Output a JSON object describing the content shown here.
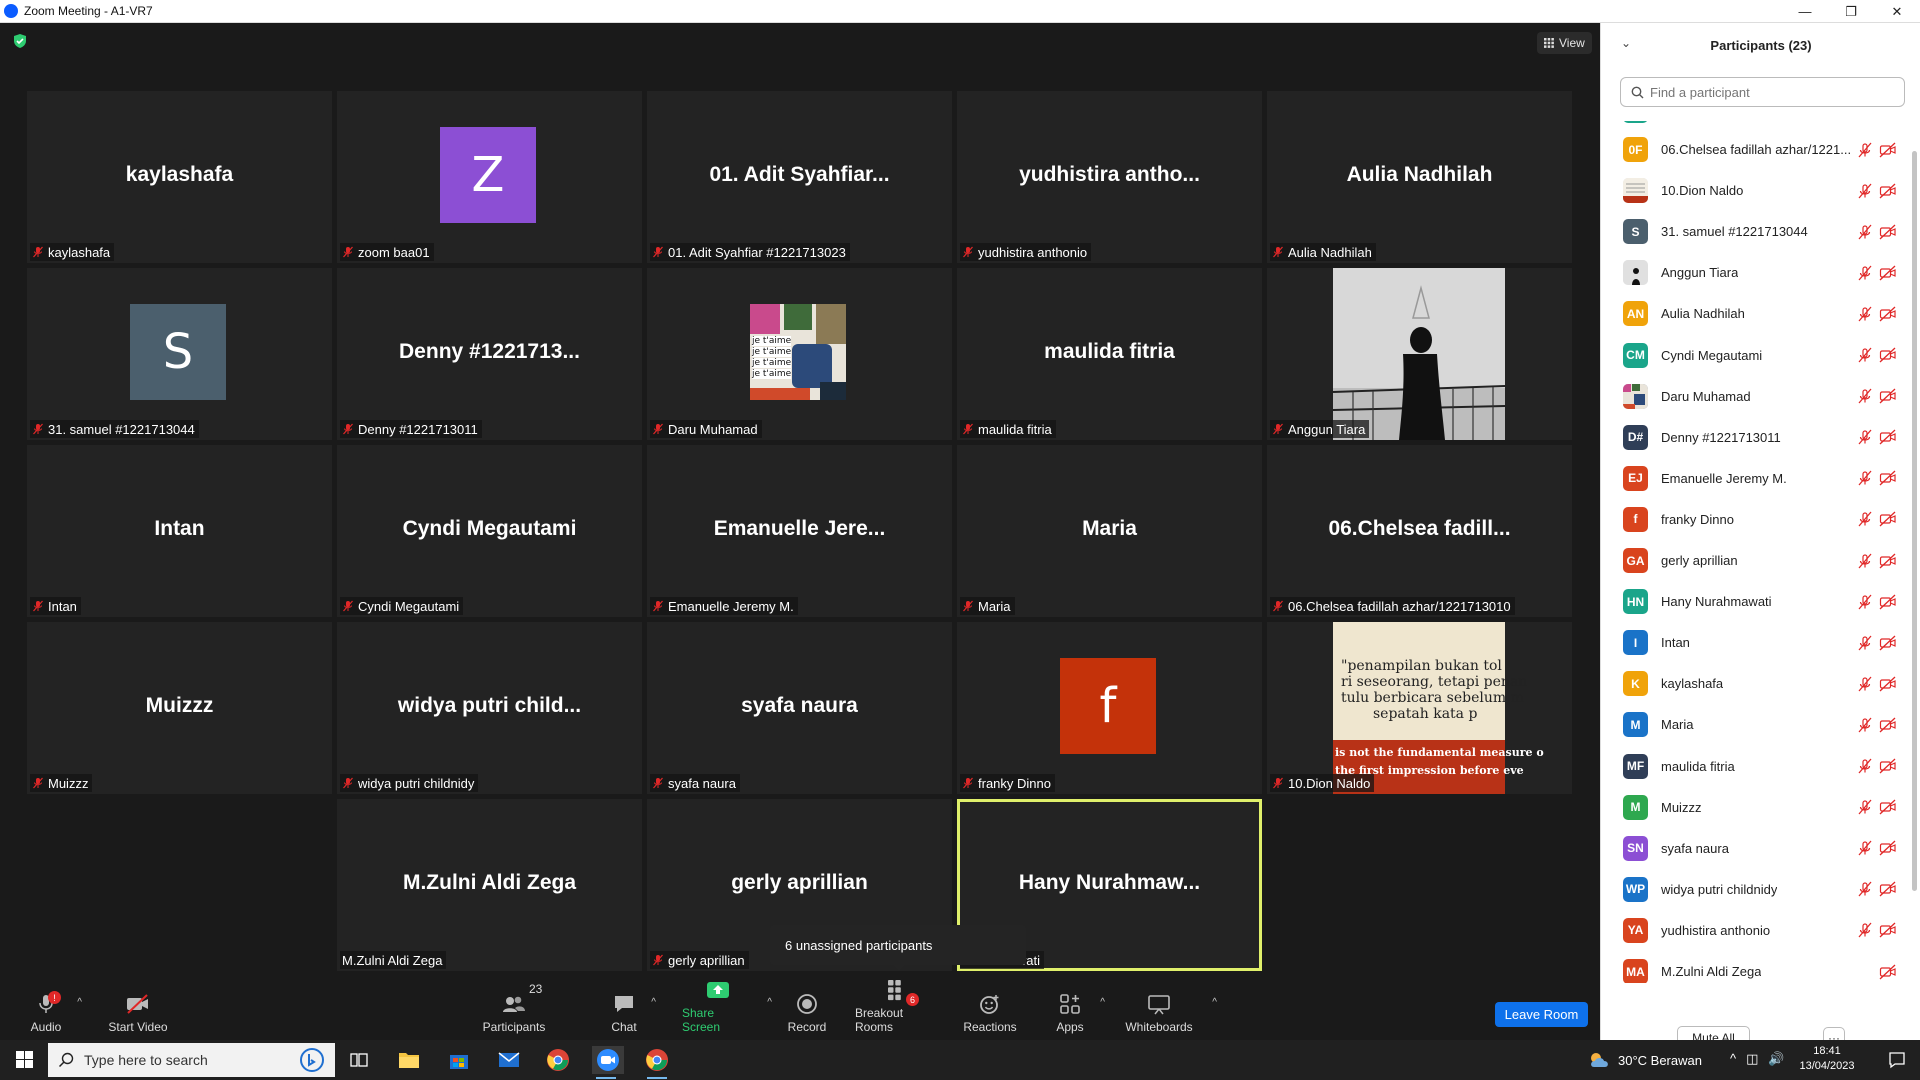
{
  "window": {
    "title": "Zoom Meeting - A1-VR7",
    "controls": [
      "—",
      "❐",
      "✕"
    ]
  },
  "meeting": {
    "view_label": "View",
    "tiles": [
      {
        "bigname": "kaylashafa",
        "label": "kaylashafa",
        "muted": true
      },
      {
        "bigname": "",
        "avatar_letter": "Z",
        "avatar_color": "#8c4fd4",
        "label": "zoom baa01",
        "muted": true
      },
      {
        "bigname": "01. Adit Syahfiar...",
        "label": "01. Adit Syahfiar #1221713023",
        "muted": true
      },
      {
        "bigname": "yudhistira  antho...",
        "label": "yudhistira anthonio",
        "muted": true
      },
      {
        "bigname": "Aulia Nadhilah",
        "label": "Aulia Nadhilah",
        "muted": true
      },
      {
        "bigname": "",
        "avatar_letter": "S",
        "avatar_color": "#4b5f6d",
        "label": "31. samuel #1221713044",
        "muted": true
      },
      {
        "bigname": "Denny #1221713...",
        "label": "Denny #1221713011",
        "muted": true
      },
      {
        "bigname": "",
        "photo": "collage",
        "photo_text": [
          "je t'aime",
          "je t'aime",
          "je t'aime",
          "je t'aime"
        ],
        "label": "Daru Muhamad",
        "muted": true
      },
      {
        "bigname": "maulida fitria",
        "label": "maulida fitria",
        "muted": true
      },
      {
        "bigname": "",
        "photo": "bw",
        "label": "Anggun Tiara",
        "muted": true
      },
      {
        "bigname": "Intan",
        "label": "Intan",
        "muted": true
      },
      {
        "bigname": "Cyndi Megautami",
        "label": "Cyndi Megautami",
        "muted": true
      },
      {
        "bigname": "Emanuelle  Jere...",
        "label": "Emanuelle Jeremy M.",
        "muted": true
      },
      {
        "bigname": "Maria",
        "label": "Maria",
        "muted": true
      },
      {
        "bigname": "06.Chelsea  fadill...",
        "label": "06.Chelsea fadillah azhar/1221713010",
        "muted": true
      },
      {
        "bigname": "Muizzz",
        "label": "Muizzz",
        "muted": true
      },
      {
        "bigname": "widya  putri  child...",
        "label": "widya putri childnidy",
        "muted": true
      },
      {
        "bigname": "syafa naura",
        "label": "syafa naura",
        "muted": true
      },
      {
        "bigname": "",
        "avatar_letter": "f",
        "avatar_color": "#c4320a",
        "label": "franky Dinno",
        "muted": true
      },
      {
        "bigname": "",
        "photo": "quote",
        "photo_text": [
          "\"penampilan bukan tol",
          "ri seseorang, tetapi penan",
          "tulu berbicara sebelum m",
          "sepatah kata p",
          "is not the fundamental measure o",
          "the first impression before eve"
        ],
        "label": "10.Dion Naldo",
        "muted": true
      },
      {
        "bigname": "M.Zulni Aldi Zega",
        "label": "M.Zulni Aldi Zega",
        "muted": false
      },
      {
        "bigname": "gerly aprillian",
        "label": "gerly aprillian",
        "muted": true
      },
      {
        "bigname": "Hany  Nurahmaw...",
        "label": "...urahmawati",
        "muted": false,
        "active": true
      }
    ],
    "tooltip": "6 unassigned participants"
  },
  "toolbar": {
    "audio": "Audio",
    "audio_badge": "!",
    "start_video": "Start Video",
    "participants": "Participants",
    "participants_count": "23",
    "chat": "Chat",
    "share_screen": "Share Screen",
    "record": "Record",
    "breakout_rooms": "Breakout Rooms",
    "breakout_badge": "6",
    "reactions": "Reactions",
    "apps": "Apps",
    "whiteboards": "Whiteboards",
    "leave_room": "Leave Room"
  },
  "participants_panel": {
    "title": "Participants (23)",
    "search_placeholder": "Find a participant",
    "mute_all": "Mute All",
    "more": "···",
    "list": [
      {
        "initials": "0F",
        "color": "#f0a30a",
        "name": "06.Chelsea fadillah azhar/1221...",
        "cam": true
      },
      {
        "initials": "",
        "color": "#d9d9d9",
        "photo": "paper",
        "name": "10.Dion Naldo",
        "cam": true
      },
      {
        "initials": "S",
        "color": "#4b5f6d",
        "name": "31. samuel #1221713044",
        "cam": true
      },
      {
        "initials": "",
        "color": "#e8e8e8",
        "photo": "person",
        "name": "Anggun Tiara",
        "cam": true
      },
      {
        "initials": "AN",
        "color": "#f0a30a",
        "name": "Aulia Nadhilah",
        "cam": true
      },
      {
        "initials": "CM",
        "color": "#1aa58a",
        "name": "Cyndi Megautami",
        "cam": true
      },
      {
        "initials": "",
        "color": "#7a8aa8",
        "photo": "collage",
        "name": "Daru Muhamad",
        "cam": true
      },
      {
        "initials": "D#",
        "color": "#2f3e57",
        "name": "Denny #1221713011",
        "cam": true
      },
      {
        "initials": "EJ",
        "color": "#d9441e",
        "name": "Emanuelle Jeremy M.",
        "cam": true
      },
      {
        "initials": "f",
        "color": "#d9441e",
        "name": "franky Dinno",
        "cam": true
      },
      {
        "initials": "GA",
        "color": "#d9441e",
        "name": "gerly aprillian",
        "cam": true
      },
      {
        "initials": "HN",
        "color": "#1aa58a",
        "name": "Hany Nurahmawati",
        "cam": true
      },
      {
        "initials": "I",
        "color": "#1a73c8",
        "name": "Intan",
        "cam": true
      },
      {
        "initials": "K",
        "color": "#f0a30a",
        "name": "kaylashafa",
        "cam": true
      },
      {
        "initials": "M",
        "color": "#1a73c8",
        "name": "Maria",
        "cam": true
      },
      {
        "initials": "MF",
        "color": "#2f3e57",
        "name": "maulida fitria",
        "cam": true
      },
      {
        "initials": "M",
        "color": "#2ea84f",
        "name": "Muizzz",
        "cam": true
      },
      {
        "initials": "SN",
        "color": "#8c4fd4",
        "name": "syafa naura",
        "cam": true
      },
      {
        "initials": "WP",
        "color": "#1a73c8",
        "name": "widya putri childnidy",
        "cam": true
      },
      {
        "initials": "YA",
        "color": "#d9441e",
        "name": "yudhistira anthonio",
        "cam": true
      },
      {
        "initials": "MA",
        "color": "#d9441e",
        "name": "M.Zulni Aldi Zega",
        "cam": true,
        "no_mic": true
      }
    ]
  },
  "taskbar": {
    "search_placeholder": "Type here to search",
    "weather": "30°C  Berawan",
    "time": "18:41",
    "date": "13/04/2023"
  }
}
